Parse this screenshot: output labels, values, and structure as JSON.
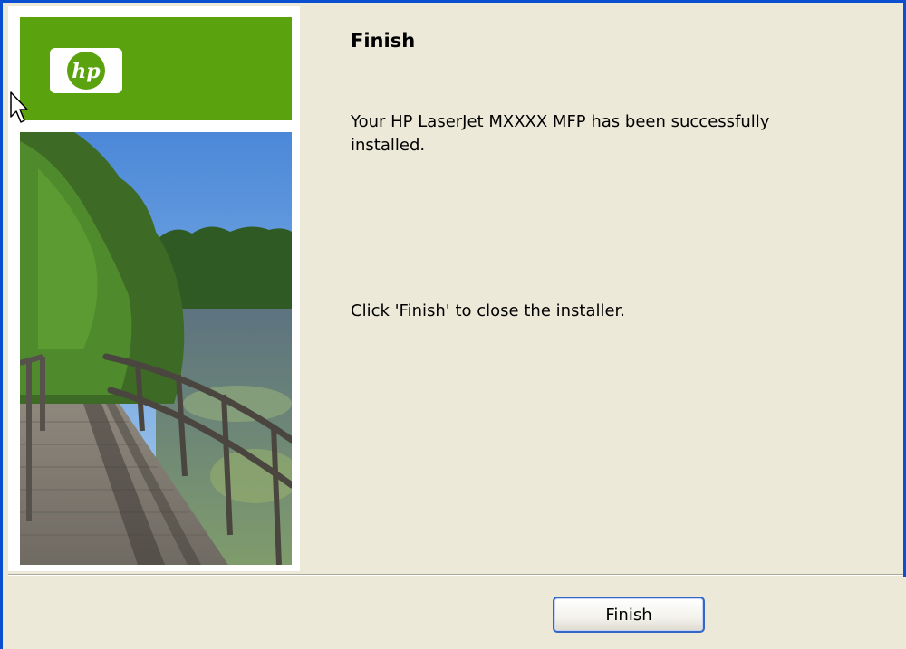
{
  "dialog": {
    "heading": "Finish",
    "message": "Your HP LaserJet MXXXX MFP has been successfully installed.",
    "instruction": "Click 'Finish' to close the installer."
  },
  "footer": {
    "finish_label": "Finish"
  },
  "branding": {
    "logo": "hp",
    "logo_band_color": "#5ba20f"
  },
  "colors": {
    "window_border": "#0a4fd0",
    "dialog_background": "#ece9d8",
    "button_border": "#3466c5"
  },
  "icons": {
    "cursor": "mouse-pointer-icon"
  }
}
